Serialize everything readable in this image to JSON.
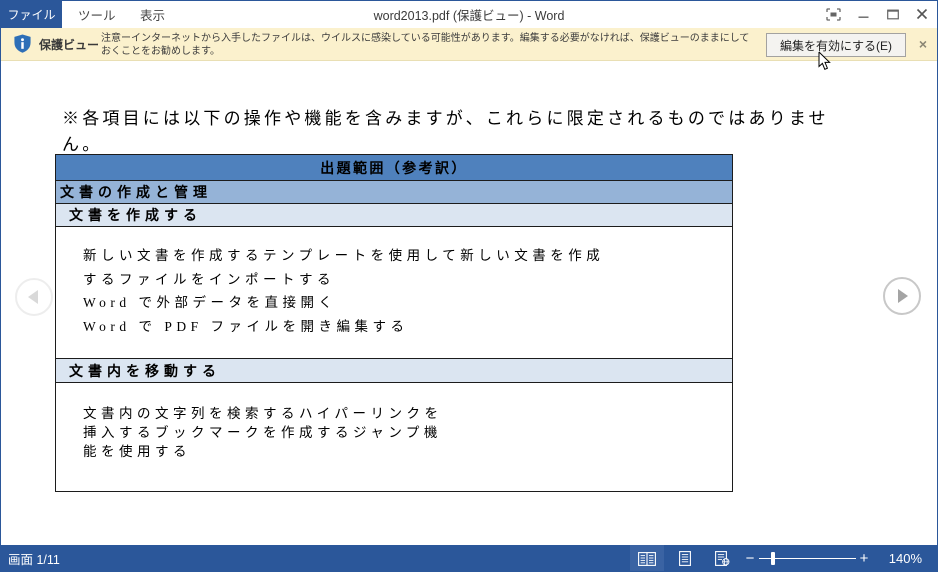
{
  "window": {
    "file_tab": "ファイル",
    "menus": [
      "ツール",
      "表示"
    ],
    "title": "word2013.pdf (保護ビュー) - Word"
  },
  "protected_view": {
    "label": "保護ビュー",
    "message_lines": [
      "注意ーインターネットから入手したファイルは、ウイルスに感染している可能性があります。編集する必要がなければ、保護ビューのままにして",
      "おくことをお勧めします。"
    ],
    "enable_button": "編集を有効にする(E)",
    "close_glyph": "×"
  },
  "document": {
    "heading_lines": [
      "※各項目には以下の操作や機能を含みますが、これらに限定されるものではありませ",
      "ん。"
    ],
    "table": {
      "header": "出題範囲（参考訳）",
      "section": "文書の作成と管理",
      "groups": [
        {
          "title": "文書を作成する",
          "lines": [
            "新しい文書を作成するテンプレートを使用して新しい文書を作成",
            "するファイルをインポートする",
            "Word で外部データを直接開く",
            "Word で PDF ファイルを開き編集する"
          ]
        },
        {
          "title": "文書内を移動する",
          "lines": [
            "文書内の文字列を検索するハイパーリンクを",
            "挿入するブックマークを作成するジャンプ機",
            "能を使用する"
          ]
        }
      ]
    }
  },
  "statusbar": {
    "page_label": "画面 1/11",
    "zoom_out_glyph": "−",
    "zoom_in_glyph": "+",
    "zoom_percent": "140%"
  },
  "colors": {
    "accent_blue": "#2b579a",
    "protected_bar_yellow": "#fbf1cd",
    "table_header_blue": "#4f81bd",
    "table_section_blue": "#95b3d7",
    "table_subsection_blue": "#dbe5f1",
    "status_active_button": "#3a63a3"
  }
}
